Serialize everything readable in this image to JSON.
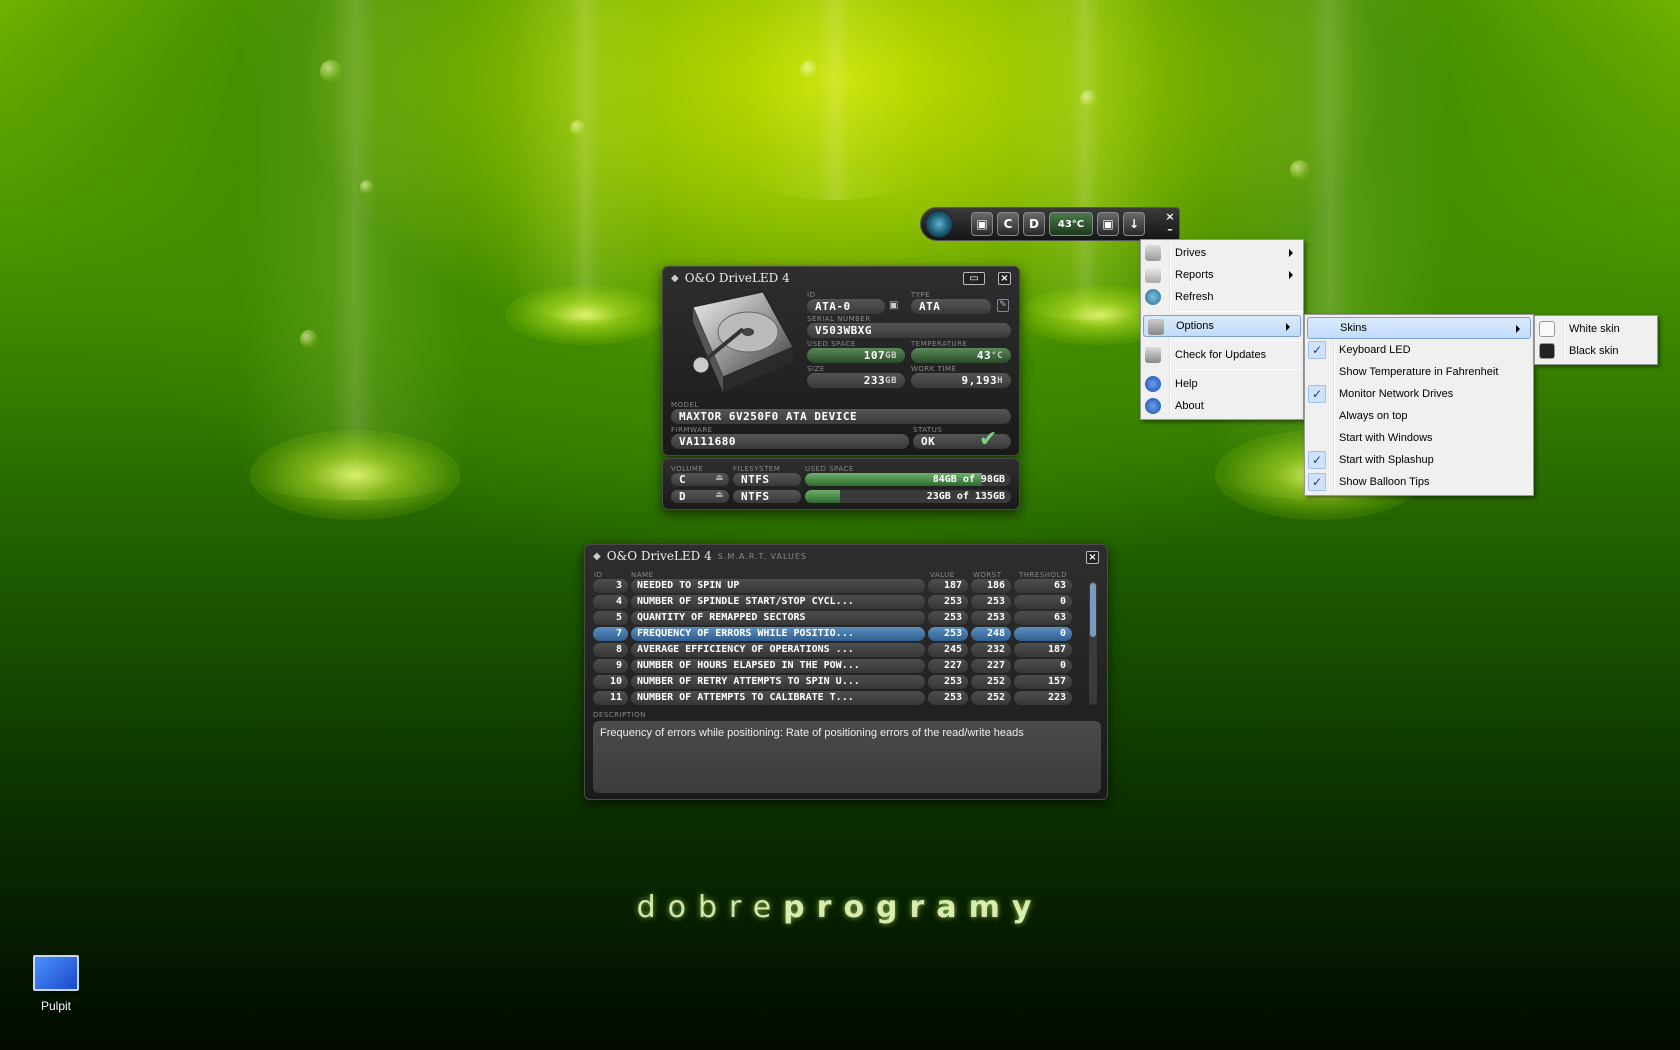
{
  "colors": {
    "accent": "#5a8fc0",
    "panel_bg": "#1f1f1f",
    "menu_bg": "#f0f0f0",
    "wallpaper": "#4a9a00"
  },
  "toolbar": {
    "drive_c": "C",
    "drive_d": "D",
    "temperature": "43°C",
    "close_label": "×",
    "minimize_label": "–"
  },
  "drive_panel": {
    "title": "O&O DriveLED 4",
    "id_label": "ID",
    "id_value": "ATA-0",
    "type_label": "TYPE",
    "type_value": "ATA",
    "serial_label": "SERIAL NUMBER",
    "serial_value": "V503WBXG",
    "used_label": "USED SPACE",
    "used_value": "107",
    "used_unit": "GB",
    "temp_label": "TEMPERATURE",
    "temp_value": "43",
    "temp_unit": "°C",
    "size_label": "SIZE",
    "size_value": "233",
    "size_unit": "GB",
    "work_label": "WORK TIME",
    "work_value": "9,193",
    "work_unit": "H",
    "model_label": "MODEL",
    "model_value": "MAXTOR 6V250F0 ATA DEVICE",
    "firmware_label": "FIRMWARE",
    "firmware_value": "VA111680",
    "status_label": "STATUS",
    "status_value": "OK"
  },
  "volume_panel": {
    "headers": {
      "volume": "VOLUME",
      "filesystem": "FILESYSTEM",
      "used": "USED SPACE"
    },
    "rows": [
      {
        "volume": "C",
        "fs": "NTFS",
        "used": "84GB of 98GB",
        "fill": 0.86
      },
      {
        "volume": "D",
        "fs": "NTFS",
        "used": "23GB of 135GB",
        "fill": 0.17
      }
    ]
  },
  "smart_panel": {
    "title": "O&O DriveLED 4",
    "subtitle": "S.M.A.R.T. VALUES",
    "headers": {
      "id": "ID",
      "name": "NAME",
      "value": "VALUE",
      "worst": "WORST",
      "threshold": "THRESHOLD"
    },
    "rows": [
      {
        "id": "3",
        "name": "NEEDED TO SPIN UP",
        "value": "187",
        "worst": "186",
        "threshold": "63"
      },
      {
        "id": "4",
        "name": "NUMBER OF SPINDLE START/STOP CYCL...",
        "value": "253",
        "worst": "253",
        "threshold": "0"
      },
      {
        "id": "5",
        "name": "QUANTITY OF REMAPPED SECTORS",
        "value": "253",
        "worst": "253",
        "threshold": "63"
      },
      {
        "id": "7",
        "name": "FREQUENCY OF ERRORS WHILE POSITIO...",
        "value": "253",
        "worst": "248",
        "threshold": "0"
      },
      {
        "id": "8",
        "name": "AVERAGE EFFICIENCY OF OPERATIONS ...",
        "value": "245",
        "worst": "232",
        "threshold": "187"
      },
      {
        "id": "9",
        "name": "NUMBER OF HOURS ELAPSED IN THE POW...",
        "value": "227",
        "worst": "227",
        "threshold": "0"
      },
      {
        "id": "10",
        "name": "NUMBER OF RETRY ATTEMPTS TO SPIN U...",
        "value": "253",
        "worst": "252",
        "threshold": "157"
      },
      {
        "id": "11",
        "name": "NUMBER OF ATTEMPTS TO CALIBRATE T...",
        "value": "253",
        "worst": "252",
        "threshold": "223"
      }
    ],
    "selected_index": 3,
    "description_label": "DESCRIPTION",
    "description": "Frequency of errors while positioning: Rate of positioning errors of the read/write heads"
  },
  "main_menu": {
    "items": [
      {
        "label": "Drives",
        "icon": "drive-icon"
      },
      {
        "label": "Reports",
        "icon": "report-icon"
      },
      {
        "label": "Refresh",
        "icon": "refresh-icon"
      },
      {
        "label": "Options",
        "icon": "options-icon"
      },
      {
        "label": "Check for Updates",
        "icon": "update-icon"
      },
      {
        "label": "Help",
        "icon": "help-icon"
      },
      {
        "label": "About",
        "icon": "info-icon"
      }
    ]
  },
  "options_menu": {
    "items": [
      {
        "label": "Skins",
        "checked": false
      },
      {
        "label": "Keyboard LED",
        "checked": true
      },
      {
        "label": "Show Temperature in Fahrenheit",
        "checked": false
      },
      {
        "label": "Monitor Network Drives",
        "checked": true
      },
      {
        "label": "Always on top",
        "checked": false
      },
      {
        "label": "Start with Windows",
        "checked": false
      },
      {
        "label": "Start with Splashup",
        "checked": true
      },
      {
        "label": "Show Balloon Tips",
        "checked": true
      }
    ]
  },
  "skins_menu": {
    "items": [
      {
        "label": "White skin"
      },
      {
        "label": "Black skin"
      }
    ]
  },
  "desktop": {
    "icon_label": "Pulpit",
    "watermark_light": "dobre",
    "watermark_bold": "programy"
  }
}
